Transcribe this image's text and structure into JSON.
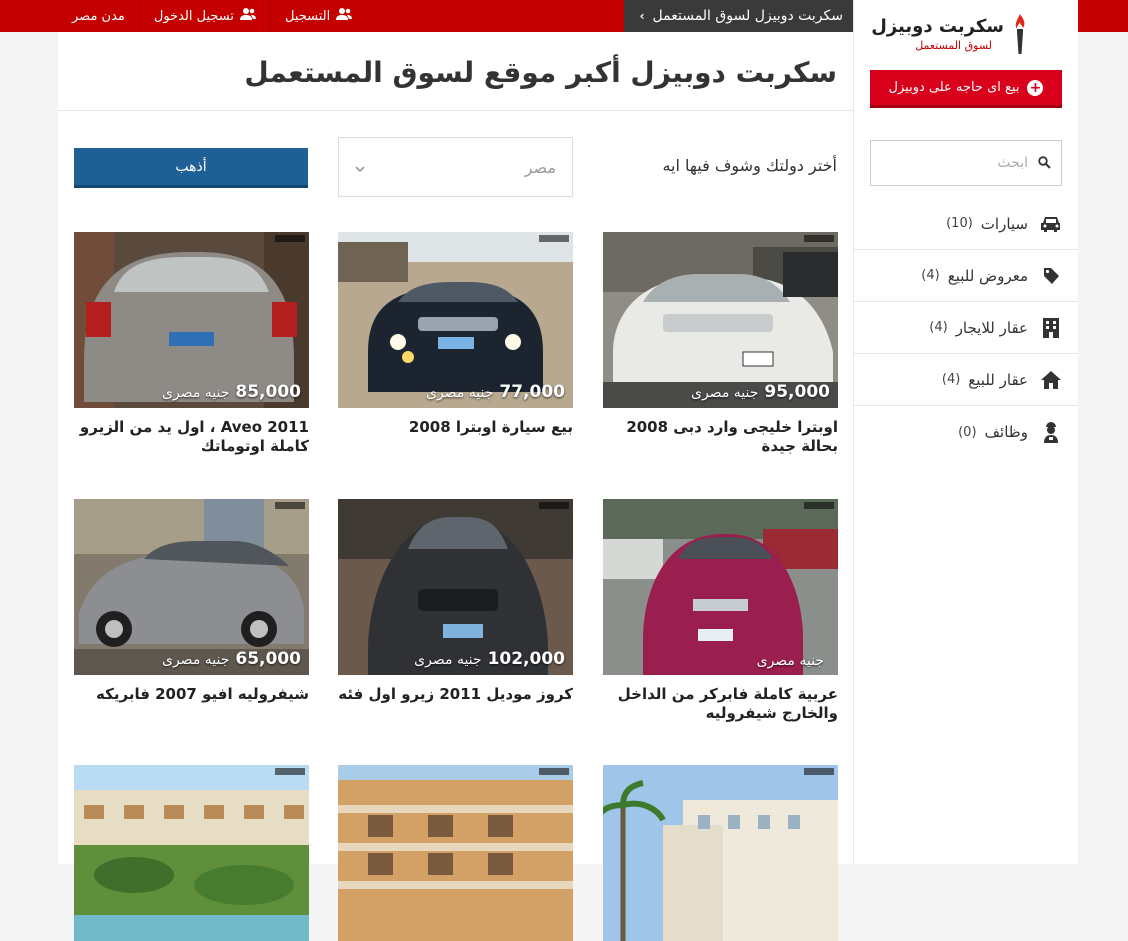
{
  "topbar": {
    "site_title": "سكربت دوبيزل لسوق المستعمل",
    "links": [
      "مدن مصر",
      "تسجيل الدخول",
      "التسجيل"
    ]
  },
  "sidebar": {
    "logo_main": "سكربت دوبيزل",
    "logo_sub": "لسوق المستعمل",
    "sell_button": "بيع اى حاجه على دوبيزل",
    "search_placeholder": "ابحث",
    "categories": [
      {
        "name": "سيارات",
        "count": "(10)",
        "icon": "car-icon"
      },
      {
        "name": "معروض للبيع",
        "count": "(4)",
        "icon": "tag-icon"
      },
      {
        "name": "عقار للايجار",
        "count": "(4)",
        "icon": "building-icon"
      },
      {
        "name": "عقار للبيع",
        "count": "(4)",
        "icon": "home-icon"
      },
      {
        "name": "وظائف",
        "count": "(0)",
        "icon": "worker-icon"
      }
    ]
  },
  "main": {
    "title": "سكربت دوبيزل أكبر موقع لسوق المستعمل",
    "country_label": "أختر دولتك وشوف فيها ايه",
    "country_value": "مصر",
    "go_button": "أذهب"
  },
  "currency": "جنيه مصرى",
  "listings": [
    {
      "title": "اوبترا خليجى وارد دبى 2008 بحالة جيدة",
      "price": "95,000"
    },
    {
      "title": "بيع سيارة اوبترا 2008",
      "price": "77,000"
    },
    {
      "title": "Aveo 2011 ، اول يد من الزيرو كاملة اوتوماتك",
      "price": "85,000"
    },
    {
      "title": "عربية كاملة فابركر من الداخل والخارج شيفروليه",
      "price": ""
    },
    {
      "title": "كروز موديل 2011 زيرو اول فئه",
      "price": "102,000"
    },
    {
      "title": "شيفروليه افيو 2007 فابريكه",
      "price": "65,000"
    },
    {
      "title": "",
      "price": ""
    },
    {
      "title": "",
      "price": ""
    },
    {
      "title": "",
      "price": ""
    }
  ],
  "colors": {
    "brand_red": "#c40000",
    "go_blue": "#1e5f95",
    "dark_bar": "#3a3a3a"
  }
}
